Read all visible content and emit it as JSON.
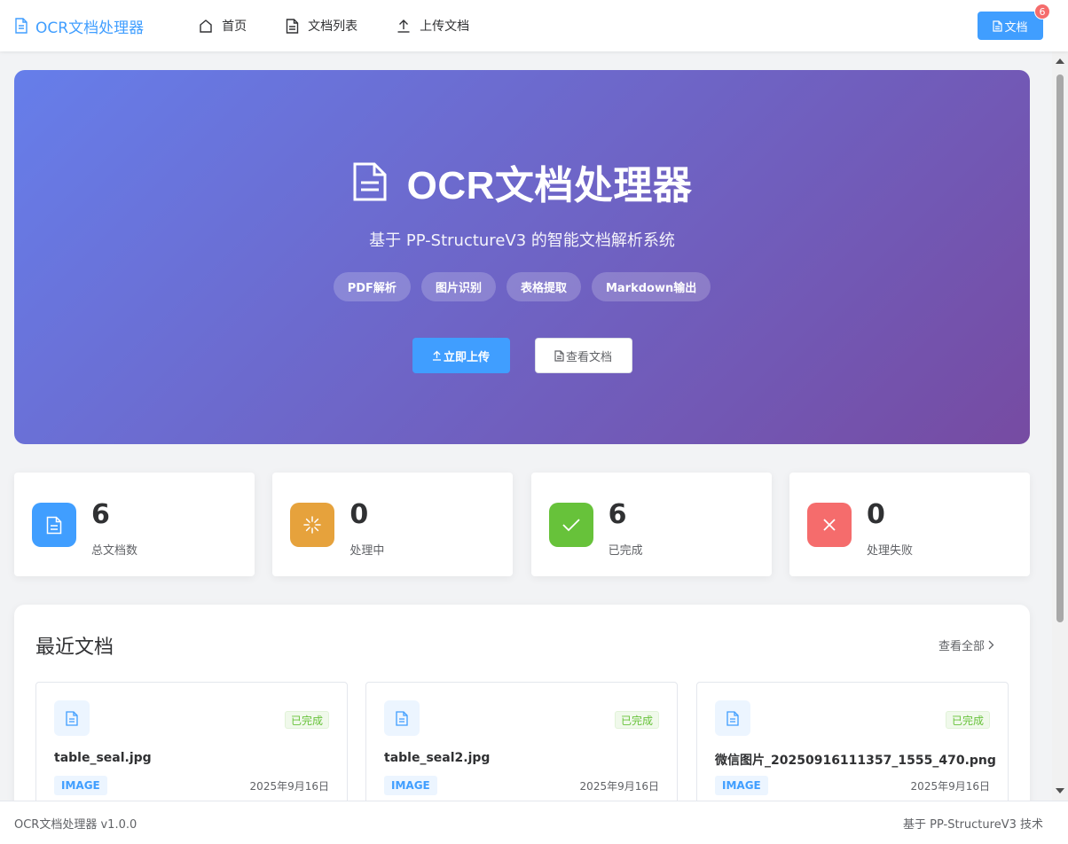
{
  "header": {
    "brand": "OCR文档处理器",
    "nav": [
      {
        "label": "首页",
        "icon": "home-icon"
      },
      {
        "label": "文档列表",
        "icon": "document-icon"
      },
      {
        "label": "上传文档",
        "icon": "upload-icon"
      }
    ],
    "doc_button_label": "文档",
    "doc_badge": "6"
  },
  "hero": {
    "title": "OCR文档处理器",
    "subtitle": "基于 PP-StructureV3 的智能文档解析系统",
    "tags": [
      "PDF解析",
      "图片识别",
      "表格提取",
      "Markdown输出"
    ],
    "upload_button": "立即上传",
    "view_button": "查看文档"
  },
  "stats": [
    {
      "value": "6",
      "label": "总文档数",
      "color": "#409eff",
      "icon": "document-icon"
    },
    {
      "value": "0",
      "label": "处理中",
      "color": "#e6a23c",
      "icon": "loading-icon"
    },
    {
      "value": "6",
      "label": "已完成",
      "color": "#67c23a",
      "icon": "check-icon"
    },
    {
      "value": "0",
      "label": "处理失败",
      "color": "#f56c6c",
      "icon": "close-icon"
    }
  ],
  "recent": {
    "title": "最近文档",
    "view_all": "查看全部",
    "docs": [
      {
        "name": "table_seal.jpg",
        "status": "已完成",
        "type": "IMAGE",
        "date": "2025年9月16日"
      },
      {
        "name": "table_seal2.jpg",
        "status": "已完成",
        "type": "IMAGE",
        "date": "2025年9月16日"
      },
      {
        "name": "微信图片_20250916111357_1555_470.png",
        "status": "已完成",
        "type": "IMAGE",
        "date": "2025年9月16日"
      }
    ]
  },
  "footer": {
    "left": "OCR文档处理器 v1.0.0",
    "right": "基于 PP-StructureV3 技术"
  },
  "colors": {
    "primary": "#409eff",
    "hero_gradient_start": "#667eea",
    "hero_gradient_end": "#764ba2",
    "success": "#67c23a",
    "warning": "#e6a23c",
    "danger": "#f56c6c"
  }
}
